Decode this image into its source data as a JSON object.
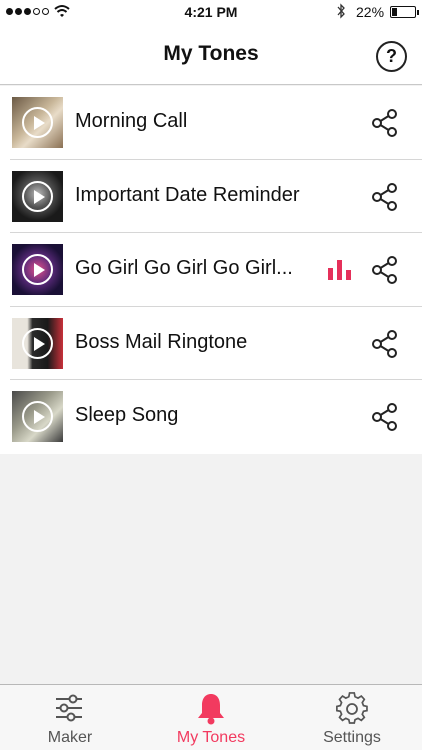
{
  "status_bar": {
    "time": "4:21 PM",
    "battery_percent": "22%",
    "battery_level": 0.22
  },
  "nav": {
    "title": "My Tones",
    "help_label": "?"
  },
  "tones": [
    {
      "title": "Morning Call",
      "playing": false
    },
    {
      "title": "Important Date Reminder",
      "playing": false
    },
    {
      "title": "Go Girl Go Girl Go Girl...",
      "playing": true
    },
    {
      "title": "Boss Mail Ringtone",
      "playing": false
    },
    {
      "title": "Sleep Song",
      "playing": false
    }
  ],
  "tabs": [
    {
      "label": "Maker",
      "icon": "sliders-icon",
      "active": false
    },
    {
      "label": "My Tones",
      "icon": "bell-icon",
      "active": true
    },
    {
      "label": "Settings",
      "icon": "gear-icon",
      "active": false
    }
  ],
  "colors": {
    "accent": "#f23a5f",
    "playing_bar": "#e5305a",
    "background": "#f2f2f2"
  }
}
